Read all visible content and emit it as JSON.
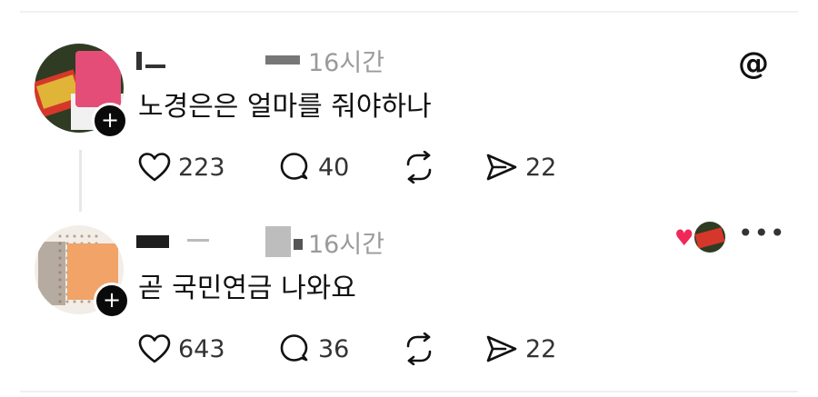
{
  "posts": [
    {
      "timestamp": "16시간",
      "text": "노경은은 얼마를 줘야하나",
      "likes": "223",
      "replies": "40",
      "shares": "22",
      "brand_icon": "threads-icon"
    },
    {
      "timestamp": "16시간",
      "text": "곧 국민연금 나와요",
      "likes": "643",
      "replies": "36",
      "shares": "22",
      "more_icon": "•••"
    }
  ],
  "icons": {
    "plus": "+",
    "heart_filled": "♥",
    "threads_logo": "@"
  },
  "colors": {
    "accent_heart": "#f0285a",
    "muted_text": "#9a9a9a",
    "text": "#111111"
  }
}
